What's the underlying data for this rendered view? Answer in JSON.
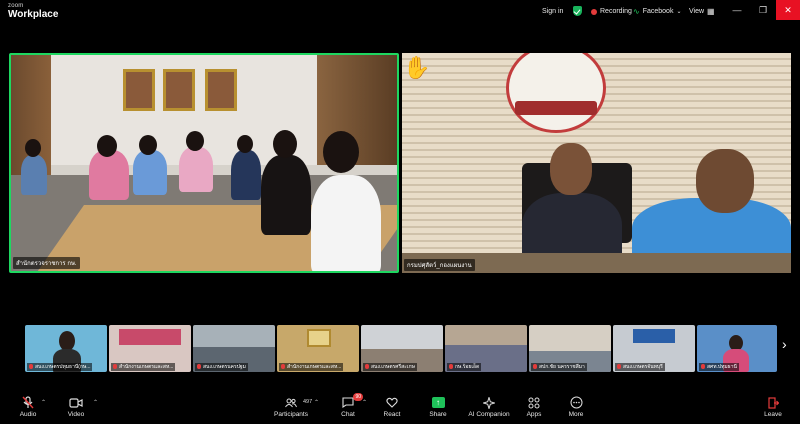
{
  "app": {
    "brand_top": "zoom",
    "brand_bottom": "Workplace"
  },
  "topbar": {
    "sign_in": "Sign in",
    "recording": "Recording",
    "facebook": "Facebook",
    "view": "View"
  },
  "main_tiles": [
    {
      "name": "สำนักตรวจราชการ กษ."
    },
    {
      "name": "กรมปศุสัตว์_กองแผนงาน"
    }
  ],
  "filmstrip": [
    {
      "name": "สนง.เกษตรปทุมธานี(กษ..."
    },
    {
      "name": "สำนักงานเกษตรและสห..."
    },
    {
      "name": "สนง.เกษตรนครปฐม"
    },
    {
      "name": "สำนักงานเกษตรและสห..."
    },
    {
      "name": "สนง.เกษตรศรีสะเกษ"
    },
    {
      "name": "กษ.ร้อยเอ็ด"
    },
    {
      "name": "สปก.ชัย นครราชสีมา"
    },
    {
      "name": "สนง.เกษตรจันทบุรี"
    },
    {
      "name": "สศท.ปทุมธานี"
    }
  ],
  "toolbar": {
    "audio": "Audio",
    "video": "Video",
    "participants": "Participants",
    "participants_count": "497",
    "chat": "Chat",
    "chat_badge": "90",
    "react": "React",
    "share": "Share",
    "ai_companion": "AI Companion",
    "apps": "Apps",
    "more": "More",
    "leave": "Leave"
  },
  "colors": {
    "active_speaker_border": "#1ed760",
    "recording": "#e43b3b",
    "share": "#1fc15a",
    "close": "#e81123"
  }
}
